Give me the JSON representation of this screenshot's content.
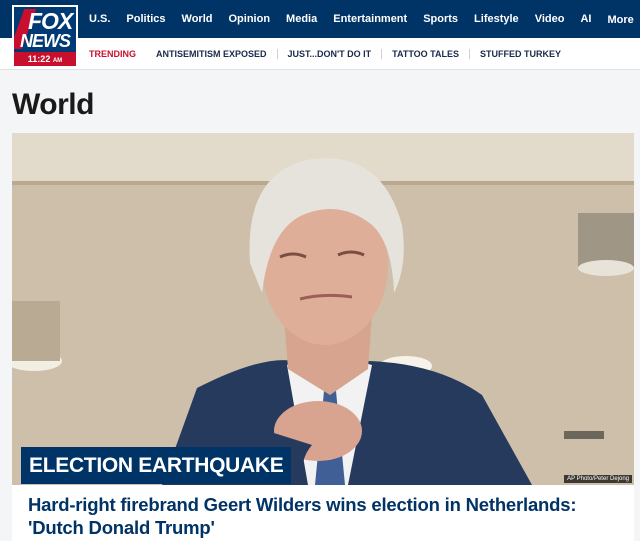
{
  "brand": {
    "line1": "FOX",
    "line2": "NEWS",
    "time": "11:22",
    "ampm": "AM"
  },
  "nav": {
    "items": [
      "U.S.",
      "Politics",
      "World",
      "Opinion",
      "Media",
      "Entertainment",
      "Sports",
      "Lifestyle",
      "Video",
      "AI"
    ],
    "more_label": "More ⋮"
  },
  "trending": {
    "label": "TRENDING",
    "items": [
      "ANTISEMITISM EXPOSED",
      "JUST...DON'T DO IT",
      "TATTOO TALES",
      "STUFFED TURKEY"
    ]
  },
  "page": {
    "title": "World"
  },
  "hero": {
    "kicker": "ELECTION EARTHQUAKE",
    "photo_credit": "AP Photo/Peter Dejong",
    "headline": "Hard-right firebrand Geert Wilders wins election in Netherlands: 'Dutch Donald Trump'"
  },
  "colors": {
    "navy": "#003366",
    "red": "#c8102e",
    "headline": "#003366"
  }
}
